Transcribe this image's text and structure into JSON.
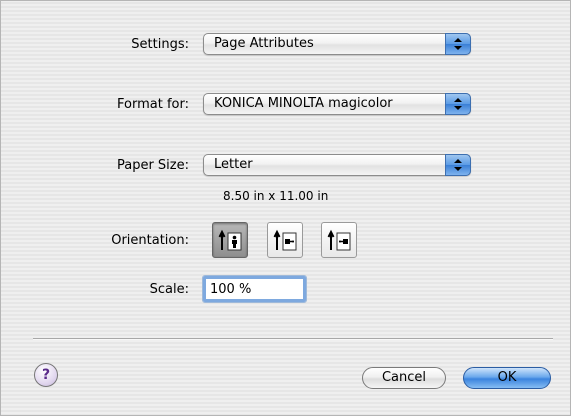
{
  "settings": {
    "label": "Settings:",
    "value": "Page Attributes"
  },
  "format_for": {
    "label": "Format for:",
    "value": "KONICA MINOLTA magicolor"
  },
  "paper_size": {
    "label": "Paper Size:",
    "value": "Letter",
    "dimensions": "8.50 in x 11.00 in"
  },
  "orientation": {
    "label": "Orientation:",
    "options": [
      {
        "name": "portrait",
        "selected": true,
        "icon": "portrait-orientation-icon"
      },
      {
        "name": "landscape-left",
        "selected": false,
        "icon": "landscape-left-orientation-icon"
      },
      {
        "name": "landscape-right",
        "selected": false,
        "icon": "landscape-right-orientation-icon"
      }
    ]
  },
  "scale": {
    "label": "Scale:",
    "value": "100 %"
  },
  "buttons": {
    "help": "?",
    "cancel": "Cancel",
    "ok": "OK"
  },
  "colors": {
    "default_button": "#3b84de",
    "focus_ring": "#7ea9df"
  }
}
